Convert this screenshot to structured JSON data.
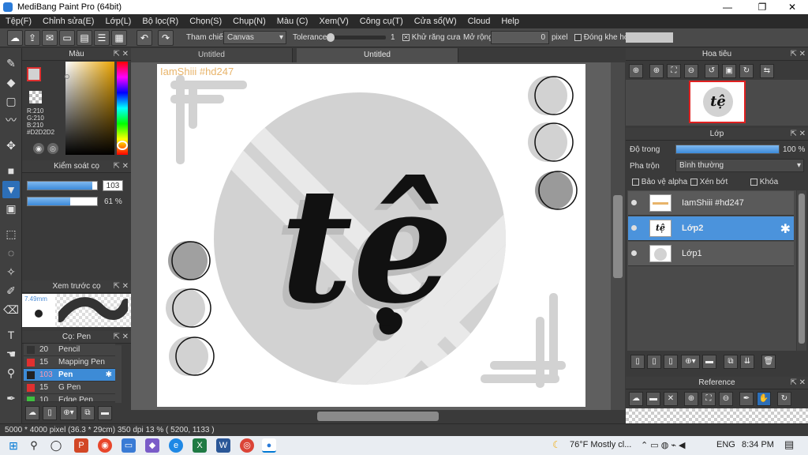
{
  "window": {
    "title": "MediBang Paint Pro (64bit)",
    "min": "—",
    "max": "❐",
    "close": "✕"
  },
  "menu": [
    "Tệp(F)",
    "Chỉnh sửa(E)",
    "Lớp(L)",
    "Bộ lọc(R)",
    "Chọn(S)",
    "Chụp(N)",
    "Màu (C)",
    "Xem(V)",
    "Công cụ(T)",
    "Cửa sổ(W)",
    "Cloud",
    "Help"
  ],
  "toolbar": {
    "reference_label": "Tham chiếu",
    "reference_value": "Canvas",
    "tolerance_label": "Tolerance",
    "tolerance_value": "1",
    "antialias_label": "Khử răng cưa",
    "expand_label": "Mở rộng",
    "expand_value": "0",
    "expand_unit": "pixel",
    "close_gap_label": "Đóng khe hở"
  },
  "color_panel": {
    "title": "Màu",
    "r": "R:210",
    "g": "G:210",
    "b": "B:210",
    "hex": "#D2D2D2",
    "primary_color": "#d2d2d2",
    "secondary_color": "#e03030"
  },
  "brush_control": {
    "title": "Kiểm soát cọ",
    "size_value": "103",
    "size_fraction": 0.93,
    "opacity_value": "61 %",
    "opacity_fraction": 0.61
  },
  "brush_preview": {
    "title": "Xem trước cọ",
    "size_label": "7.49mm"
  },
  "brushes": {
    "title": "Cọ: Pen",
    "items": [
      {
        "size": "20",
        "name": "Pencil",
        "color": "#333333"
      },
      {
        "size": "15",
        "name": "Mapping Pen",
        "color": "#e03030"
      },
      {
        "size": "103",
        "name": "Pen",
        "color": "#222222"
      },
      {
        "size": "15",
        "name": "G Pen",
        "color": "#e03030"
      },
      {
        "size": "10",
        "name": "Edge Pen",
        "color": "#3fbf3f"
      }
    ]
  },
  "tabs": [
    "Untitled",
    "Untitled"
  ],
  "canvas": {
    "watermark": "IamShiii #hd247",
    "main_text": "tệ"
  },
  "navigator": {
    "title": "Hoa tiêu"
  },
  "layers": {
    "title": "Lớp",
    "opacity_label": "Độ trong",
    "opacity_value": "100 %",
    "blend_label": "Pha trộn",
    "blend_value": "Bình thường",
    "protect_alpha": "Bảo vệ alpha",
    "clipping": "Xén bớt",
    "lock": "Khóa",
    "items": [
      {
        "name": "IamShiii #hd247"
      },
      {
        "name": "Lớp2"
      },
      {
        "name": "Lớp1"
      }
    ]
  },
  "reference_panel": {
    "title": "Reference"
  },
  "status": "5000 * 4000 pixel  (36.3 * 29cm)  350 dpi  13 %  ( 5200, 1133 )",
  "taskbar": {
    "weather": "76°F  Mostly cl...",
    "lang": "ENG",
    "time": "8:34 PM"
  }
}
